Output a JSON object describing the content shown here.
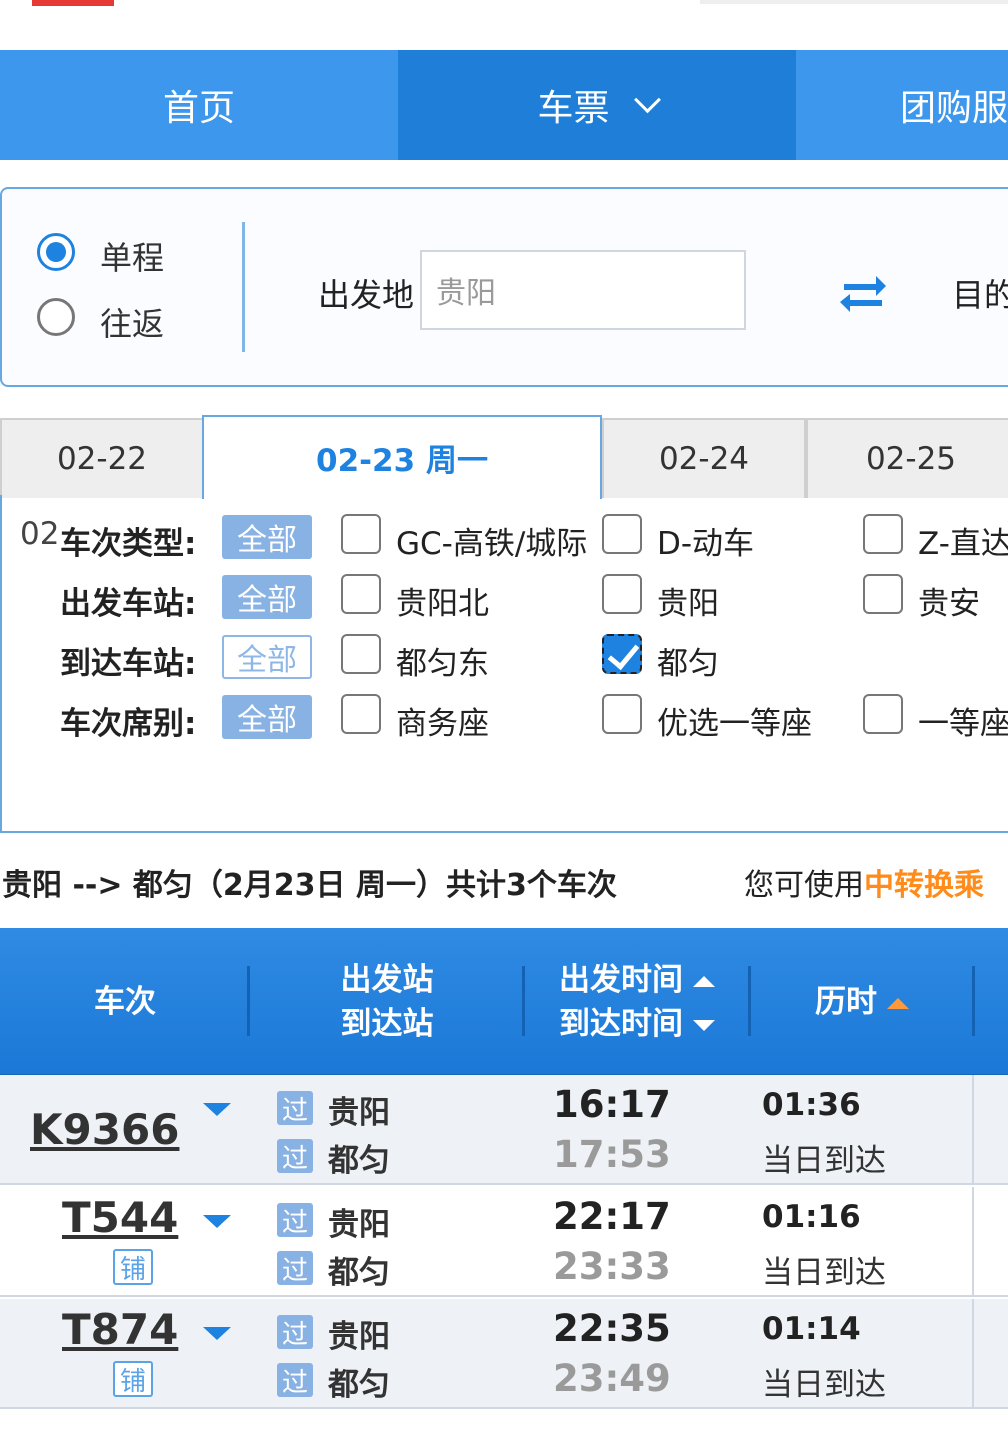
{
  "nav": {
    "home": "首页",
    "tickets": "车票",
    "group": "团购服"
  },
  "search": {
    "trip_types": [
      "单程",
      "往返"
    ],
    "selected_trip": "单程",
    "from_label": "出发地",
    "from_value": "贵阳",
    "to_label": "目的"
  },
  "dates": {
    "tabs": [
      "02-22",
      "02-23 周一",
      "02-24",
      "02-25"
    ],
    "active": "02-23 周一",
    "overflow_text": "02"
  },
  "filters": {
    "all_label": "全部",
    "rows": [
      {
        "label": "车次类型:",
        "options": [
          "GC-高铁/城际",
          "D-动车",
          "Z-直达"
        ]
      },
      {
        "label": "出发车站:",
        "options": [
          "贵阳北",
          "贵阳",
          "贵安"
        ]
      },
      {
        "label": "到达车站:",
        "options": [
          "都匀东",
          "都匀"
        ]
      },
      {
        "label": "车次席别:",
        "options": [
          "商务座",
          "优选一等座",
          "一等座"
        ]
      }
    ],
    "checked": [
      "都匀"
    ]
  },
  "summary": {
    "route": "贵阳 --> 都匀（2月23日  周一）共计3个车次",
    "hint_prefix": "您可使用",
    "hint_link": "中转换乘"
  },
  "table": {
    "headers": {
      "train": "车次",
      "dep_station": "出发站",
      "arr_station": "到达站",
      "dep_time": "出发时间",
      "arr_time": "到达时间",
      "duration": "历时"
    },
    "pass_badge": "过",
    "sleeper_badge": "铺",
    "rows": [
      {
        "train": "K9366",
        "sleeper": false,
        "from": "贵阳",
        "to": "都匀",
        "dep": "16:17",
        "arr": "17:53",
        "duration": "01:36",
        "arrive_note": "当日到达"
      },
      {
        "train": "T544",
        "sleeper": true,
        "from": "贵阳",
        "to": "都匀",
        "dep": "22:17",
        "arr": "23:33",
        "duration": "01:16",
        "arrive_note": "当日到达"
      },
      {
        "train": "T874",
        "sleeper": true,
        "from": "贵阳",
        "to": "都匀",
        "dep": "22:35",
        "arr": "23:49",
        "duration": "01:14",
        "arrive_note": "当日到达"
      }
    ]
  }
}
